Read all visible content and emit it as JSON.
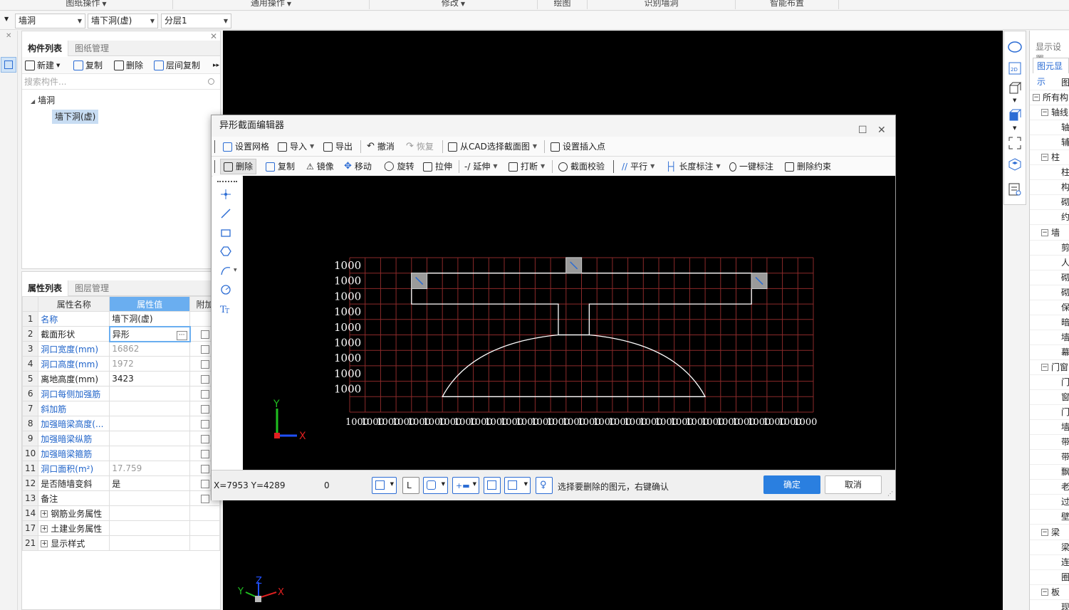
{
  "ribbon": {
    "groups": [
      "图纸操作",
      "通用操作",
      "修改",
      "绘图",
      "识别墙洞",
      "智能布置"
    ]
  },
  "combos": {
    "category": "墙洞",
    "component": "墙下洞(虚)",
    "layer": "分层1"
  },
  "component_panel": {
    "tab_active": "构件列表",
    "tab_inactive": "图纸管理",
    "toolbar": {
      "new": "新建",
      "copy": "复制",
      "delete": "删除",
      "floor_copy": "层间复制"
    },
    "search_placeholder": "搜索构件...",
    "tree_root": "墙洞",
    "tree_child": "墙下洞(虚)"
  },
  "property_panel": {
    "tab_active": "属性列表",
    "tab_inactive": "图层管理",
    "headers": {
      "name": "属性名称",
      "value": "属性值",
      "extra": "附加"
    },
    "rows": [
      {
        "num": "1",
        "name": "名称",
        "value": "墙下洞(虚)",
        "blue": true,
        "gray": false,
        "check": false
      },
      {
        "num": "2",
        "name": "截面形状",
        "value": "异形",
        "blue": false,
        "gray": false,
        "check": true
      },
      {
        "num": "3",
        "name": "洞口宽度(mm)",
        "value": "16862",
        "blue": true,
        "gray": true,
        "check": true
      },
      {
        "num": "4",
        "name": "洞口高度(mm)",
        "value": "1972",
        "blue": true,
        "gray": true,
        "check": true
      },
      {
        "num": "5",
        "name": "离地高度(mm)",
        "value": "3423",
        "blue": false,
        "gray": false,
        "check": true
      },
      {
        "num": "6",
        "name": "洞口每侧加强筋",
        "value": "",
        "blue": true,
        "gray": false,
        "check": true
      },
      {
        "num": "7",
        "name": "斜加筋",
        "value": "",
        "blue": true,
        "gray": false,
        "check": true
      },
      {
        "num": "8",
        "name": "加强暗梁高度(...",
        "value": "",
        "blue": true,
        "gray": false,
        "check": true
      },
      {
        "num": "9",
        "name": "加强暗梁纵筋",
        "value": "",
        "blue": true,
        "gray": false,
        "check": true
      },
      {
        "num": "10",
        "name": "加强暗梁箍筋",
        "value": "",
        "blue": true,
        "gray": false,
        "check": true
      },
      {
        "num": "11",
        "name": "洞口面积(m²)",
        "value": "17.759",
        "blue": true,
        "gray": true,
        "check": true
      },
      {
        "num": "12",
        "name": "是否随墙变斜",
        "value": "是",
        "blue": false,
        "gray": false,
        "check": true
      },
      {
        "num": "13",
        "name": "备注",
        "value": "",
        "blue": false,
        "gray": false,
        "check": true
      }
    ],
    "groups": [
      {
        "num": "14",
        "name": "钢筋业务属性"
      },
      {
        "num": "17",
        "name": "土建业务属性"
      },
      {
        "num": "21",
        "name": "显示样式"
      }
    ]
  },
  "display_panel": {
    "title": "显示设置",
    "tab": "图元显示",
    "rows": [
      {
        "t": "图",
        "indent": 2,
        "box": false
      },
      {
        "t": "所有构",
        "indent": 0,
        "box": true
      },
      {
        "t": "轴线",
        "indent": 1,
        "box": true
      },
      {
        "t": "轴",
        "indent": 2,
        "box": false
      },
      {
        "t": "辅",
        "indent": 2,
        "box": false
      },
      {
        "t": "柱",
        "indent": 1,
        "box": true
      },
      {
        "t": "柱",
        "indent": 2,
        "box": false
      },
      {
        "t": "构",
        "indent": 2,
        "box": false
      },
      {
        "t": "砌",
        "indent": 2,
        "box": false
      },
      {
        "t": "约",
        "indent": 2,
        "box": false
      },
      {
        "t": "墙",
        "indent": 1,
        "box": true
      },
      {
        "t": "剪",
        "indent": 2,
        "box": false
      },
      {
        "t": "人",
        "indent": 2,
        "box": false
      },
      {
        "t": "砌",
        "indent": 2,
        "box": false
      },
      {
        "t": "砌",
        "indent": 2,
        "box": false
      },
      {
        "t": "保",
        "indent": 2,
        "box": false
      },
      {
        "t": "暗",
        "indent": 2,
        "box": false
      },
      {
        "t": "墙",
        "indent": 2,
        "box": false
      },
      {
        "t": "幕",
        "indent": 2,
        "box": false
      },
      {
        "t": "门窗",
        "indent": 1,
        "box": true
      },
      {
        "t": "门",
        "indent": 2,
        "box": false
      },
      {
        "t": "窗",
        "indent": 2,
        "box": false
      },
      {
        "t": "门",
        "indent": 2,
        "box": false
      },
      {
        "t": "墙",
        "indent": 2,
        "box": false
      },
      {
        "t": "带",
        "indent": 2,
        "box": false
      },
      {
        "t": "带",
        "indent": 2,
        "box": false
      },
      {
        "t": "飘",
        "indent": 2,
        "box": false
      },
      {
        "t": "老",
        "indent": 2,
        "box": false
      },
      {
        "t": "过",
        "indent": 2,
        "box": false
      },
      {
        "t": "壁",
        "indent": 2,
        "box": false
      },
      {
        "t": "梁",
        "indent": 1,
        "box": true
      },
      {
        "t": "梁",
        "indent": 2,
        "box": false
      },
      {
        "t": "连",
        "indent": 2,
        "box": false
      },
      {
        "t": "圈",
        "indent": 2,
        "box": false
      },
      {
        "t": "板",
        "indent": 1,
        "box": true
      },
      {
        "t": "现",
        "indent": 2,
        "box": false
      }
    ]
  },
  "dialog": {
    "title": "异形截面编辑器",
    "toolbar1": {
      "grid": "设置网格",
      "import": "导入",
      "export": "导出",
      "undo": "撤消",
      "redo": "恢复",
      "from_cad": "从CAD选择截面图",
      "insert_point": "设置插入点"
    },
    "toolbar2": {
      "delete": "删除",
      "copy": "复制",
      "mirror": "镜像",
      "move": "移动",
      "rotate": "旋转",
      "stretch": "拉伸",
      "extend": "延伸",
      "break": "打断",
      "section_check": "截面校验",
      "parallel": "平行",
      "length_dim": "长度标注",
      "auto_dim": "一键标注",
      "delete_constraint": "删除约束"
    },
    "grid_label": "1000",
    "grid_rows": 10,
    "grid_cols": 30,
    "status": {
      "coords": "X=7953 Y=4289",
      "value": "0",
      "hint": "选择要删除的图元，右键确认"
    },
    "ok": "确定",
    "cancel": "取消"
  },
  "axis": {
    "x": "X",
    "y": "Y",
    "z": "Z"
  },
  "colors": {
    "accent": "#2a7fe0",
    "grid": "#8b2a2a",
    "shape": "#ffffff",
    "axis_x": "#e02020",
    "axis_y": "#20c020",
    "axis_z": "#2050ff"
  }
}
